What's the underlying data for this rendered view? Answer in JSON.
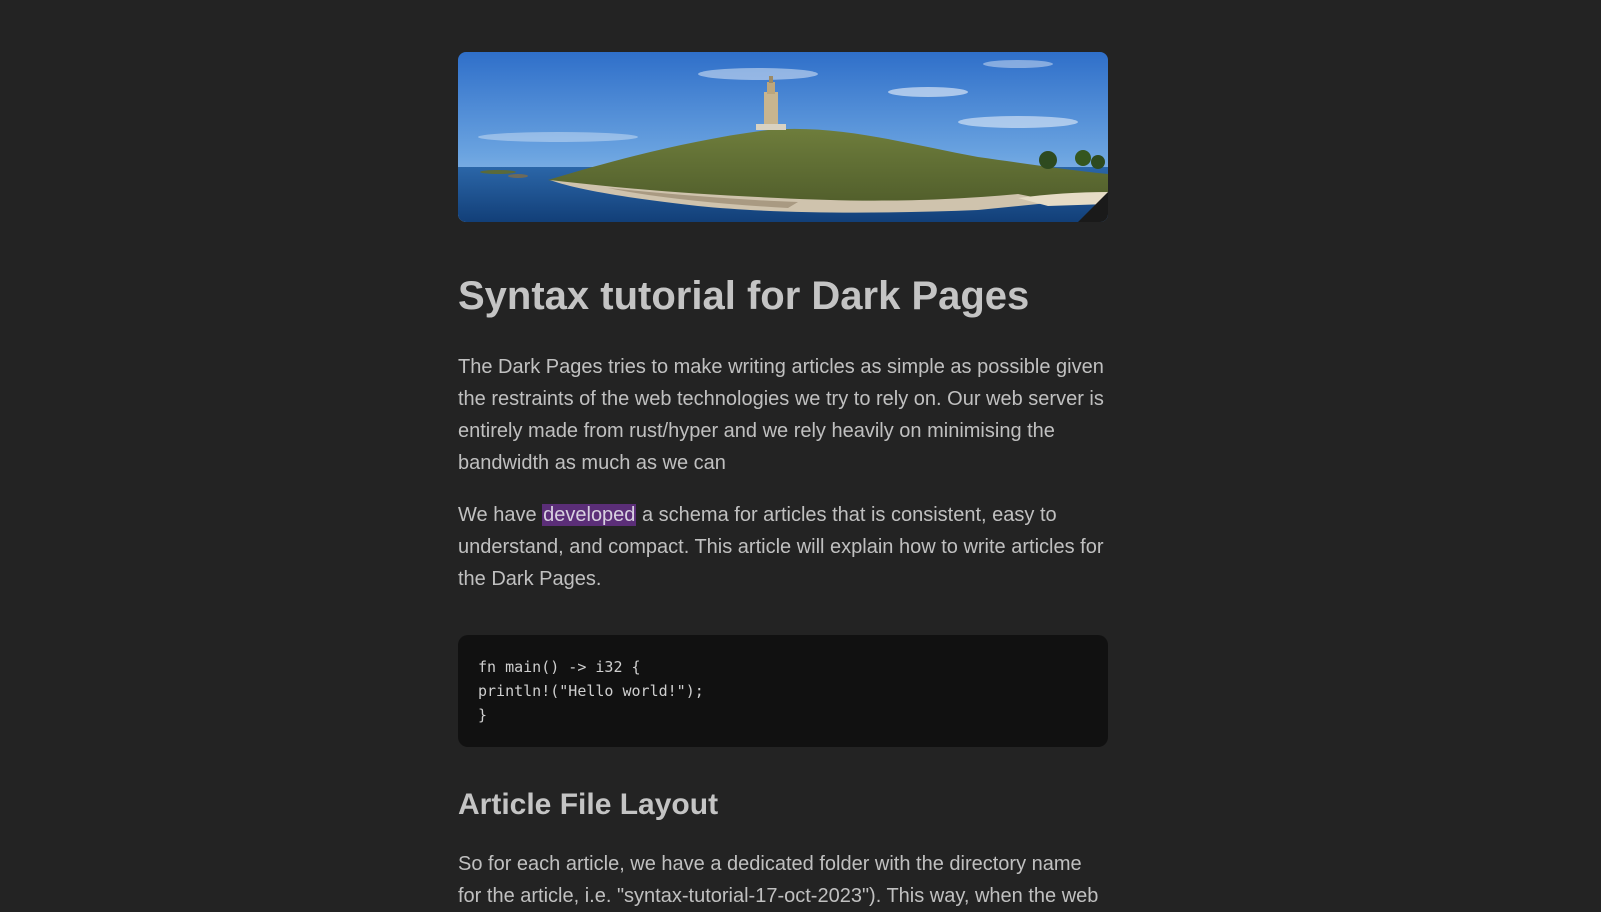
{
  "article": {
    "title": "Syntax tutorial for Dark Pages",
    "intro": "The Dark Pages tries to make writing articles as simple as possible given the restraints of the web technologies we try to rely on. Our web server is entirely made from rust/hyper and we rely heavily on minimising the bandwidth as much as we can",
    "second_before": "We have ",
    "second_highlight": "developed",
    "second_after": " a schema for articles that is consistent, easy to understand, and compact. This article will explain how to write articles for the Dark Pages.",
    "code_lines": [
      "fn main() -> i32 {",
      "println!(\"Hello world!\");",
      "}"
    ],
    "section_heading": "Article File Layout",
    "section_paragraph": "So for each article, we have a dedicated folder with the directory name",
    "section_paragraph_cont": "for the article, i.e. \"syntax-tutorial-17-oct-2023\"). This way, when the web"
  },
  "colors": {
    "background": "#232323",
    "text": "#c0c0c0",
    "code_background": "#111111",
    "highlight": "#5b2e78"
  }
}
